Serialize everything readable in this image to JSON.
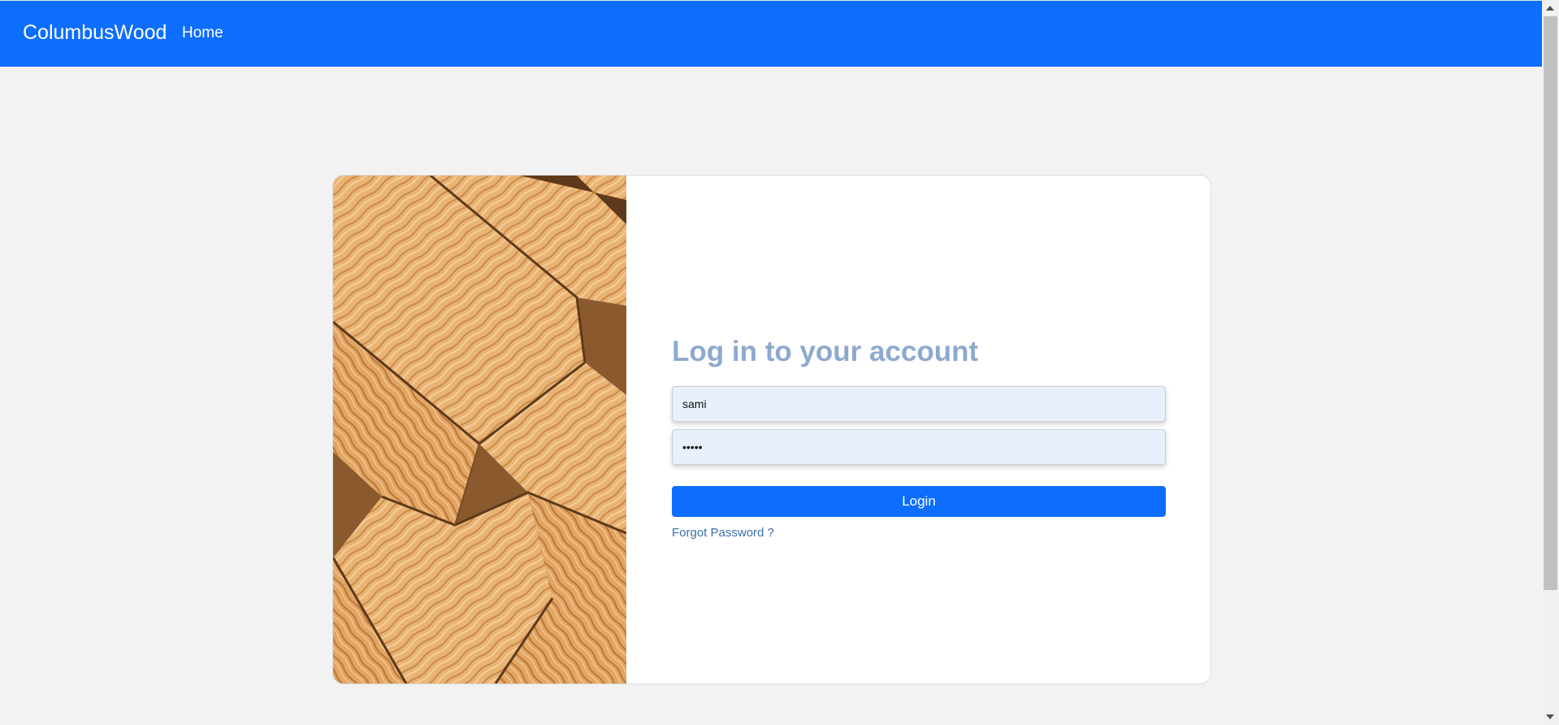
{
  "navbar": {
    "brand": "ColumbusWood",
    "home_label": "Home",
    "color": "#0d6efd"
  },
  "login": {
    "title": "Log in to your account",
    "username_value": "sami",
    "password_value": "sami1",
    "button_label": "Login",
    "forgot_label": "Forgot Password ?",
    "title_color": "#8ea9cf"
  },
  "page": {
    "background": "#f2f2f2"
  }
}
